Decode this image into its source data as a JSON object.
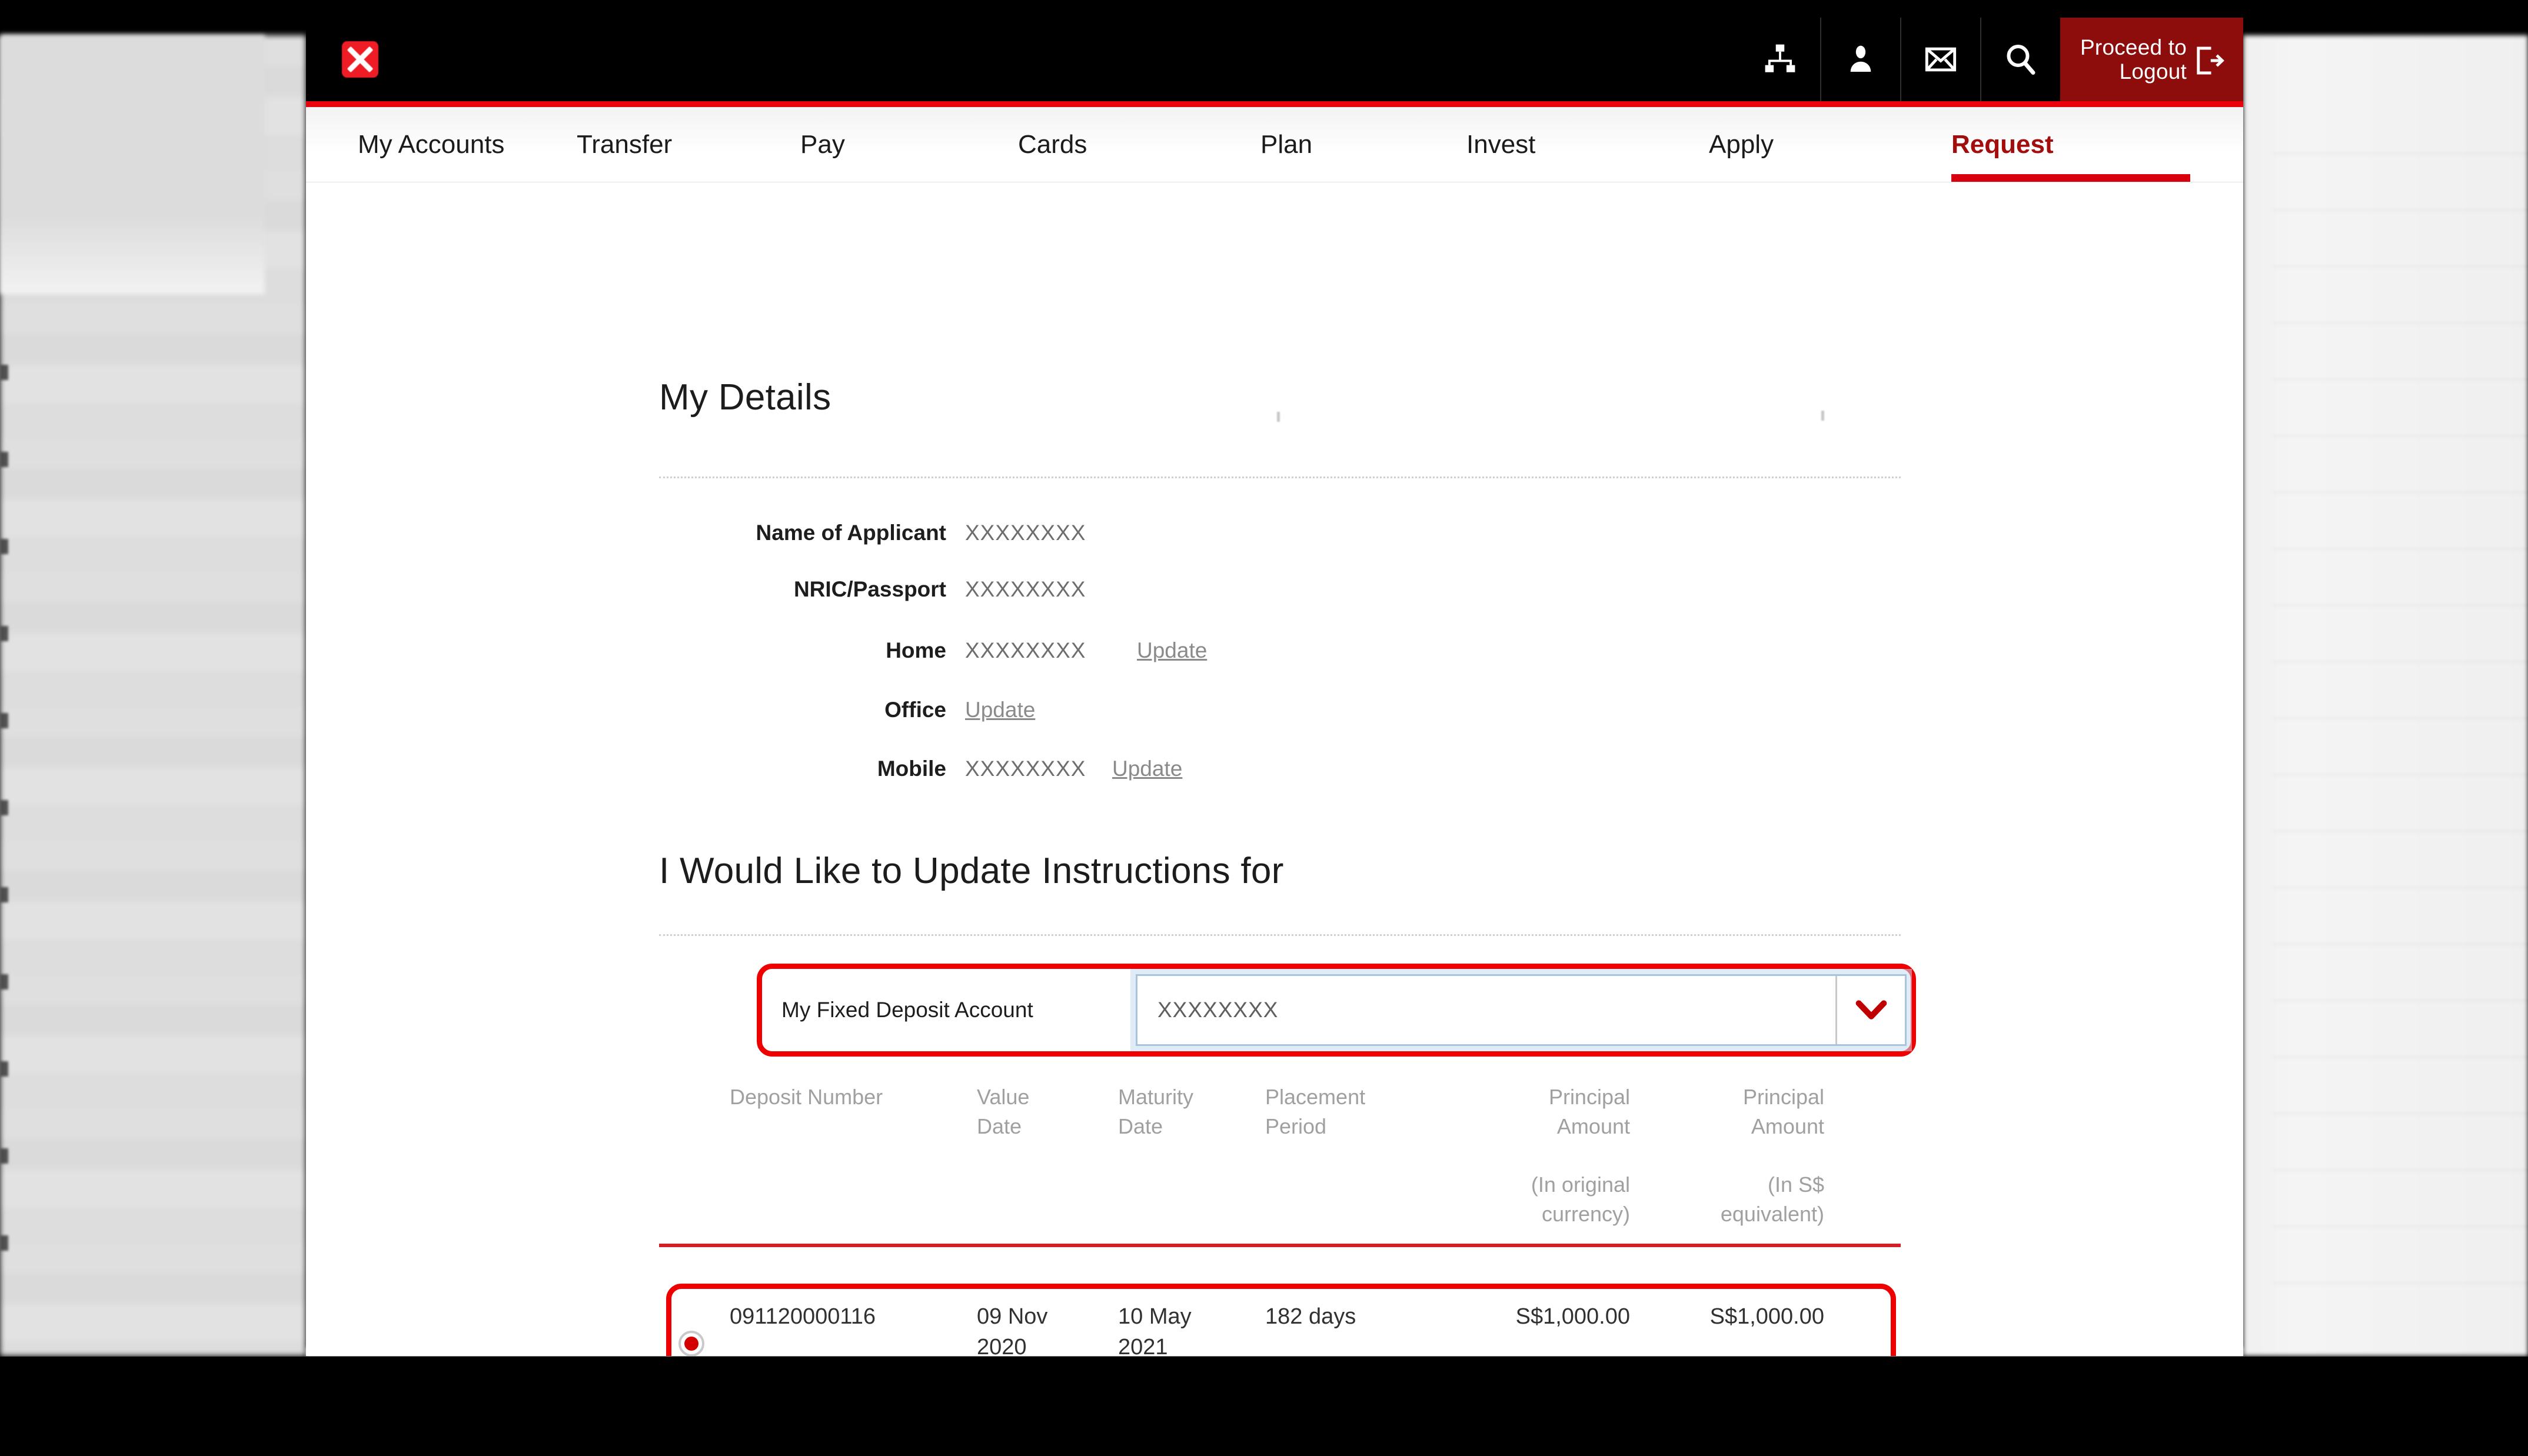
{
  "topbar": {
    "logo_icon": "bank-x-logo",
    "icons": [
      {
        "name": "sitemap-icon",
        "label": "Sitemap"
      },
      {
        "name": "profile-icon",
        "label": "Profile"
      },
      {
        "name": "mail-icon",
        "label": "Messages"
      },
      {
        "name": "search-icon",
        "label": "Search"
      }
    ],
    "logout_label": "Proceed to\nLogout",
    "logout_icon": "logout-arrow-icon",
    "bg_color": "#000000",
    "logout_bg_color": "#8d0c0c",
    "accent_rule_color": "#e8000d"
  },
  "nav": {
    "items": [
      {
        "label": "My Accounts",
        "active": false
      },
      {
        "label": "Transfer",
        "active": false
      },
      {
        "label": "Pay",
        "active": false
      },
      {
        "label": "Cards",
        "active": false
      },
      {
        "label": "Plan",
        "active": false
      },
      {
        "label": "Invest",
        "active": false
      },
      {
        "label": "Apply",
        "active": false
      },
      {
        "label": "Request",
        "active": true
      }
    ],
    "active_color": "#a20d0d",
    "underline_color": "#d9000d"
  },
  "my_details": {
    "title": "My Details",
    "rows": [
      {
        "label": "Name of Applicant",
        "value": "XXXXXXXX",
        "update": null
      },
      {
        "label": "NRIC/Passport",
        "value": "XXXXXXXX",
        "update": null
      },
      {
        "label": "Home",
        "value": "XXXXXXXX",
        "update": "Update"
      },
      {
        "label": "Office",
        "value": "",
        "update": "Update"
      },
      {
        "label": "Mobile",
        "value": "XXXXXXXX",
        "update": "Update"
      }
    ]
  },
  "instructions": {
    "title": "I Would Like to Update Instructions for",
    "account_selector": {
      "label": "My Fixed Deposit Account",
      "value": "XXXXXXXX",
      "arrow_icon": "chevron-down-icon",
      "arrow_color": "#c00000",
      "highlight_color": "#ee0000"
    }
  },
  "deposit_table": {
    "columns": [
      "Deposit Number",
      "Value\nDate",
      "Maturity\nDate",
      "Placement\nPeriod",
      "Principal\nAmount\n\n(In original\ncurrency)",
      "Principal\nAmount\n\n(In S$\nequivalent)"
    ],
    "divider_color": "#d12028",
    "rows": [
      {
        "selected": true,
        "deposit_number": "091120000116",
        "value_date": "09 Nov\n2020",
        "maturity_date": "10 May\n2021",
        "placement_period": "182 days",
        "principal_original": "S$1,000.00",
        "principal_sgd": "S$1,000.00"
      }
    ],
    "row_highlight_color": "#ee0000",
    "radio_selected_color": "#d40000"
  }
}
